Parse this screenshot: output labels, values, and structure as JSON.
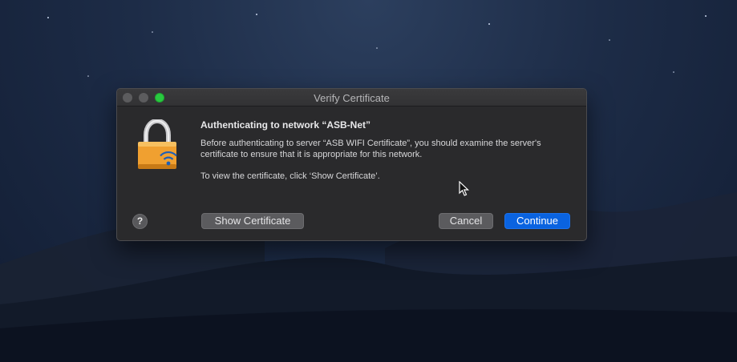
{
  "window": {
    "title": "Verify Certificate"
  },
  "dialog": {
    "heading": "Authenticating to network “ASB-Net”",
    "message": "Before authenticating to server “ASB WIFI Certificate”, you should examine the server's certificate to ensure that it is appropriate for this network.",
    "hint": "To view the certificate, click ‘Show Certificate’.",
    "icon": "wifi-padlock-icon"
  },
  "buttons": {
    "help": "?",
    "show_certificate": "Show Certificate",
    "cancel": "Cancel",
    "continue": "Continue"
  },
  "colors": {
    "primary_button": "#0a63e0",
    "zoom_light": "#29c940",
    "lock_body": "#f0a030"
  }
}
